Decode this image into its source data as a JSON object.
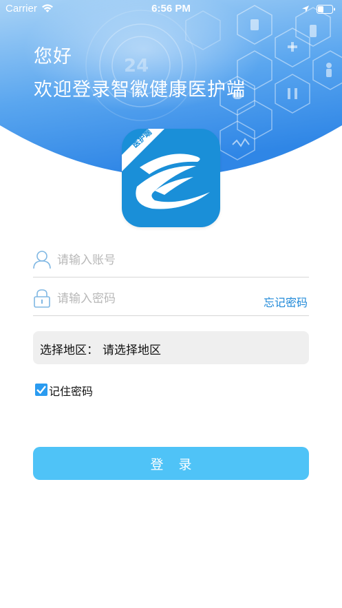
{
  "status_bar": {
    "carrier": "Carrier",
    "time": "6:56 PM"
  },
  "header": {
    "greeting": "您好",
    "welcome": "欢迎登录智徽健康医护端",
    "background_text": "24",
    "gradient_top": "#8cc3f3",
    "gradient_bottom": "#3d8fe8"
  },
  "logo": {
    "badge_text": "医护端",
    "color": "#1a8fd8"
  },
  "form": {
    "account_placeholder": "请输入账号",
    "password_placeholder": "请输入密码",
    "forgot_label": "忘记密码",
    "region_label": "选择地区：",
    "region_value": "请选择地区",
    "remember_label": "记住密码",
    "remember_checked": true,
    "login_label": "登录",
    "accent_color": "#1e88d8",
    "button_color": "#4fc3f7"
  }
}
